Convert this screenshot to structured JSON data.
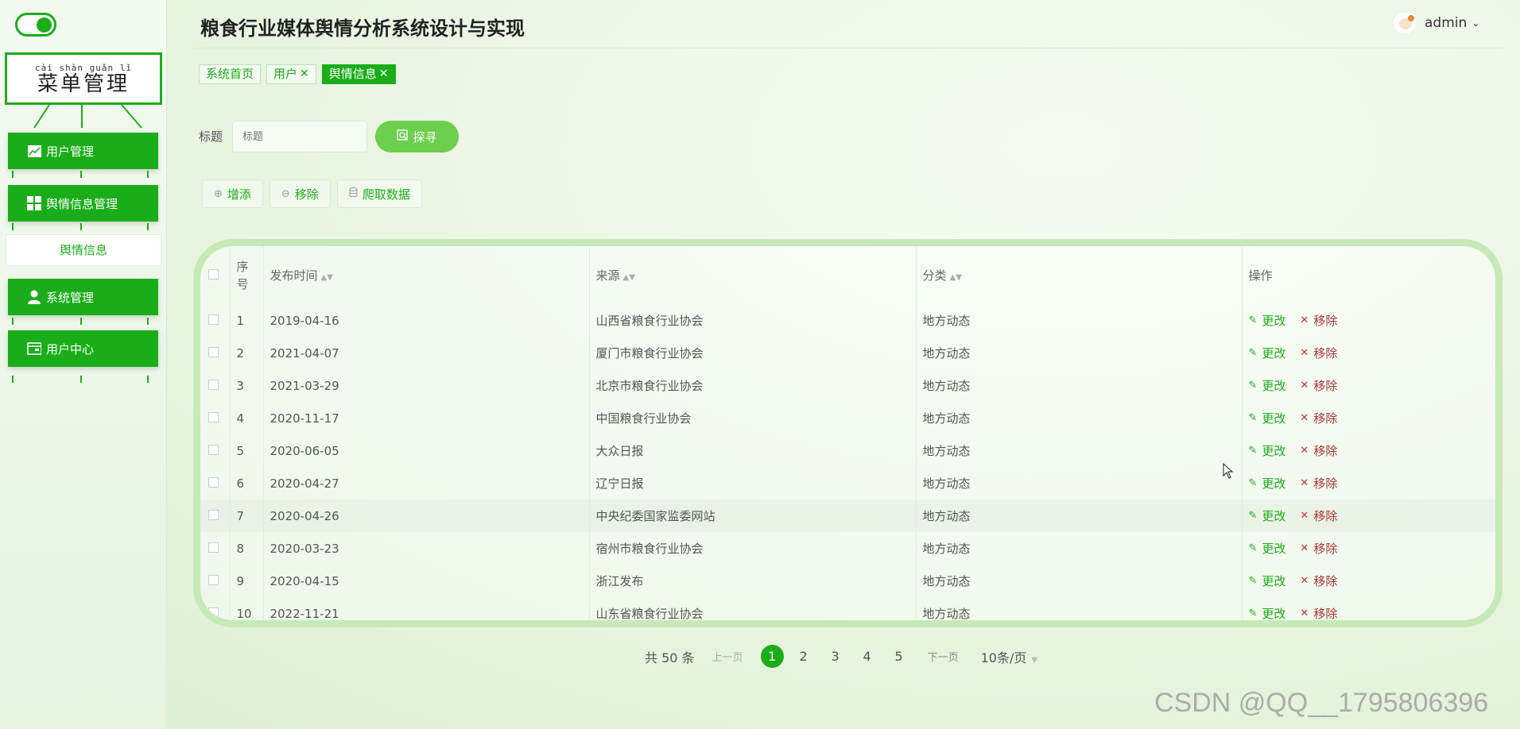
{
  "sidebar": {
    "menu_title": "菜单管理",
    "menu_title_pinyin": "cài shàn guǎn lǐ",
    "items": [
      {
        "label": "用户管理",
        "icon": "chart-icon"
      },
      {
        "label": "舆情信息管理",
        "icon": "grid-icon"
      },
      {
        "label": "舆情信息",
        "icon": ""
      },
      {
        "label": "系统管理",
        "icon": "person-icon"
      },
      {
        "label": "用户中心",
        "icon": "card-icon"
      }
    ]
  },
  "header": {
    "title": "粮食行业媒体舆情分析系统设计与实现",
    "username": "admin"
  },
  "tabs": [
    {
      "label": "系统首页",
      "closable": false,
      "active": false
    },
    {
      "label": "用户",
      "closable": true,
      "active": false
    },
    {
      "label": "舆情信息",
      "closable": true,
      "active": true
    }
  ],
  "search": {
    "label": "标题",
    "placeholder": "标题",
    "button_label": "探寻"
  },
  "actions": {
    "add_label": "增添",
    "remove_label": "移除",
    "crawl_label": "爬取数据"
  },
  "table": {
    "headers": {
      "index": "序号",
      "time": "发布时间",
      "source": "来源",
      "category": "分类",
      "ops": "操作"
    },
    "edit_label": "更改",
    "delete_label": "移除",
    "rows": [
      {
        "idx": "1",
        "time": "2019-04-16",
        "source": "山西省粮食行业协会",
        "category": "地方动态"
      },
      {
        "idx": "2",
        "time": "2021-04-07",
        "source": "厦门市粮食行业协会",
        "category": "地方动态"
      },
      {
        "idx": "3",
        "time": "2021-03-29",
        "source": "北京市粮食行业协会",
        "category": "地方动态"
      },
      {
        "idx": "4",
        "time": "2020-11-17",
        "source": "中国粮食行业协会",
        "category": "地方动态"
      },
      {
        "idx": "5",
        "time": "2020-06-05",
        "source": "大众日报",
        "category": "地方动态"
      },
      {
        "idx": "6",
        "time": "2020-04-27",
        "source": "辽宁日报",
        "category": "地方动态"
      },
      {
        "idx": "7",
        "time": "2020-04-26",
        "source": "中央纪委国家监委网站",
        "category": "地方动态"
      },
      {
        "idx": "8",
        "time": "2020-03-23",
        "source": "宿州市粮食行业协会",
        "category": "地方动态"
      },
      {
        "idx": "9",
        "time": "2020-04-15",
        "source": "浙江发布",
        "category": "地方动态"
      },
      {
        "idx": "10",
        "time": "2022-11-21",
        "source": "山东省粮食行业协会",
        "category": "地方动态"
      }
    ]
  },
  "pagination": {
    "total": "共 50 条",
    "prev": "上一页",
    "pages": [
      "1",
      "2",
      "3",
      "4",
      "5"
    ],
    "current": "1",
    "next": "下一页",
    "page_size": "10条/页"
  },
  "watermark": "CSDN @QQ__1795806396",
  "colors": {
    "accent": "#1aad19",
    "delete": "#aa3333",
    "table_border": "#c7e9b8"
  }
}
